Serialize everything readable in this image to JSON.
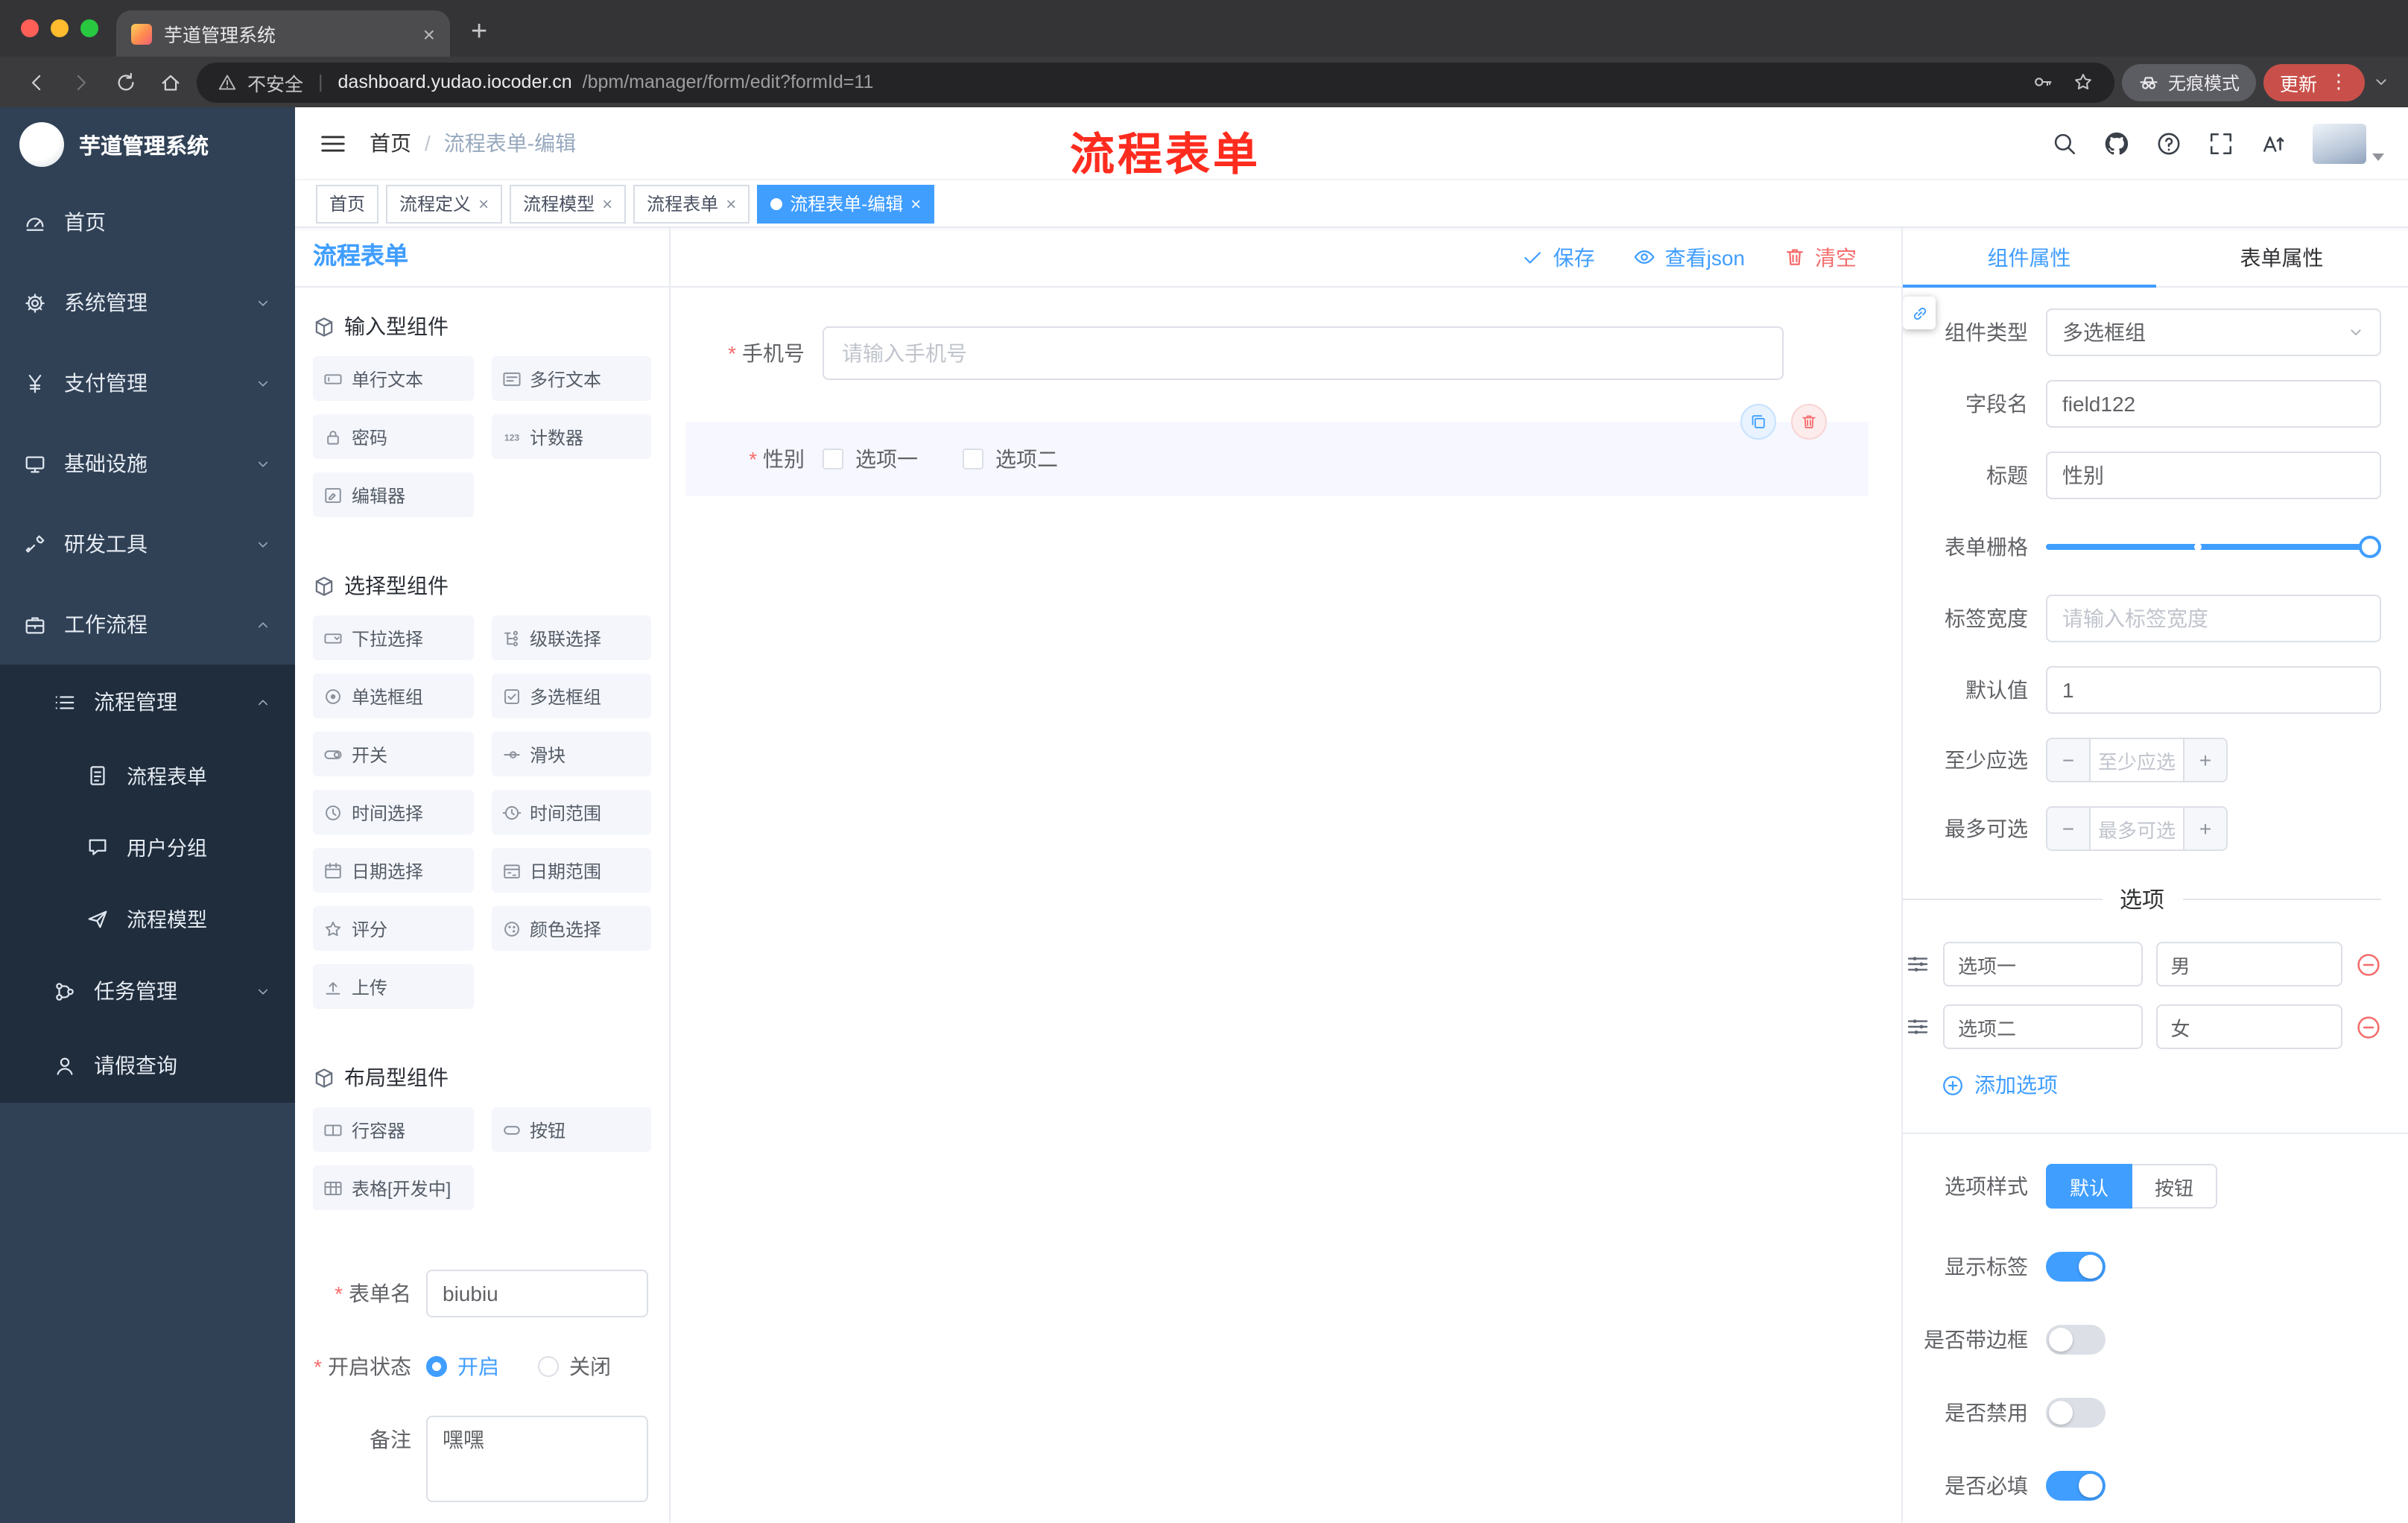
{
  "browser": {
    "tab_title": "芋道管理系统",
    "security_label": "不安全",
    "url_host": "dashboard.yudao.iocoder.cn",
    "url_path": "/bpm/manager/form/edit?formId=11",
    "incognito_label": "无痕模式",
    "update_label": "更新"
  },
  "sidebar": {
    "app_title": "芋道管理系统",
    "menu": [
      {
        "label": "首页",
        "icon": "#s-dash"
      },
      {
        "label": "系统管理",
        "icon": "#s-gear"
      },
      {
        "label": "支付管理",
        "icon": "#s-yen"
      },
      {
        "label": "基础设施",
        "icon": "#s-infra"
      },
      {
        "label": "研发工具",
        "icon": "#s-tool"
      },
      {
        "label": "工作流程",
        "icon": "#s-flow",
        "children": [
          {
            "label": "流程管理",
            "icon": "#s-list",
            "children": [
              {
                "label": "流程表单",
                "icon": "#s-doc"
              },
              {
                "label": "用户分组",
                "icon": "#s-chat"
              },
              {
                "label": "流程模型",
                "icon": "#s-send"
              }
            ]
          },
          {
            "label": "任务管理",
            "icon": "#s-task"
          },
          {
            "label": "请假查询",
            "icon": "#s-user"
          }
        ]
      }
    ]
  },
  "header": {
    "breadcrumb": {
      "home": "首页",
      "separator": "/",
      "current": "流程表单-编辑"
    },
    "annotation": "流程表单",
    "icons": [
      "search",
      "github",
      "help",
      "fullscreen",
      "font-size",
      "avatar"
    ]
  },
  "tags": {
    "items": [
      {
        "label": "首页"
      },
      {
        "label": "流程定义"
      },
      {
        "label": "流程模型"
      },
      {
        "label": "流程表单"
      },
      {
        "label": "流程表单-编辑"
      }
    ]
  },
  "designer": {
    "panel_title": "流程表单",
    "toolbar": {
      "save": "保存",
      "view_json": "查看json",
      "clear": "清空"
    },
    "palette": {
      "sections": [
        {
          "title": "输入型组件",
          "items": [
            {
              "label": "单行文本",
              "icon": "#i-input"
            },
            {
              "label": "多行文本",
              "icon": "#i-textarea"
            },
            {
              "label": "密码",
              "icon": "#i-lock"
            },
            {
              "label": "计数器",
              "icon": "#i-counter"
            },
            {
              "label": "编辑器",
              "icon": "#i-editor"
            }
          ]
        },
        {
          "title": "选择型组件",
          "items": [
            {
              "label": "下拉选择",
              "icon": "#i-select"
            },
            {
              "label": "级联选择",
              "icon": "#i-cascade"
            },
            {
              "label": "单选框组",
              "icon": "#i-radio"
            },
            {
              "label": "多选框组",
              "icon": "#i-checkbox"
            },
            {
              "label": "开关",
              "icon": "#i-switch"
            },
            {
              "label": "滑块",
              "icon": "#i-slider"
            },
            {
              "label": "时间选择",
              "icon": "#i-time"
            },
            {
              "label": "时间范围",
              "icon": "#i-timerange"
            },
            {
              "label": "日期选择",
              "icon": "#i-date"
            },
            {
              "label": "日期范围",
              "icon": "#i-daterange"
            },
            {
              "label": "评分",
              "icon": "#i-rate"
            },
            {
              "label": "颜色选择",
              "icon": "#i-color"
            },
            {
              "label": "上传",
              "icon": "#i-upload"
            }
          ]
        },
        {
          "title": "布局型组件",
          "items": [
            {
              "label": "行容器",
              "icon": "#i-row"
            },
            {
              "label": "按钮",
              "icon": "#i-button"
            },
            {
              "label": "表格[开发中]",
              "icon": "#i-table"
            }
          ]
        }
      ]
    },
    "form_meta": {
      "name_label": "表单名",
      "name_value": "biubiu",
      "status_label": "开启状态",
      "status_on": "开启",
      "status_off": "关闭",
      "remark_label": "备注",
      "remark_value": "嘿嘿"
    },
    "canvas": {
      "phone_label": "手机号",
      "phone_placeholder": "请输入手机号",
      "gender_label": "性别",
      "gender_option1": "选项一",
      "gender_option2": "选项二"
    }
  },
  "properties": {
    "tab_component": "组件属性",
    "tab_form": "表单属性",
    "component_type_label": "组件类型",
    "component_type_value": "多选框组",
    "field_name_label": "字段名",
    "field_name_value": "field122",
    "title_label": "标题",
    "title_value": "性别",
    "grid_label": "表单栅格",
    "label_width_label": "标签宽度",
    "label_width_placeholder": "请输入标签宽度",
    "default_label": "默认值",
    "default_value": "1",
    "min_label": "至少应选",
    "min_placeholder": "至少应选",
    "max_label": "最多可选",
    "max_placeholder": "最多可选",
    "options_title": "选项",
    "options": [
      {
        "label": "选项一",
        "value": "男"
      },
      {
        "label": "选项二",
        "value": "女"
      }
    ],
    "add_option": "添加选项",
    "style_label": "选项样式",
    "style_default": "默认",
    "style_button": "按钮",
    "switch_show_label": "显示标签",
    "switch_border": "是否带边框",
    "switch_disabled": "是否禁用",
    "switch_required": "是否必填"
  },
  "colors": {
    "accent": "#409eff",
    "danger": "#f56c6c",
    "annotation": "#fe2c1f",
    "sidebar": "#304156"
  }
}
